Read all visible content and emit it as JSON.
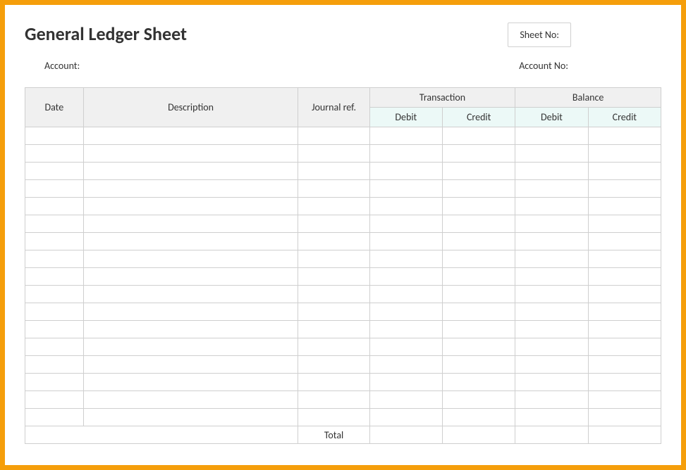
{
  "title": "General Ledger Sheet",
  "labels": {
    "sheet_no": "Sheet No:",
    "account": "Account:",
    "account_no": "Account No:"
  },
  "headers": {
    "date": "Date",
    "description": "Description",
    "journal_ref": "Journal ref.",
    "transaction": "Transaction",
    "balance": "Balance",
    "debit": "Debit",
    "credit": "Credit"
  },
  "total_label": "Total",
  "row_count": 17
}
